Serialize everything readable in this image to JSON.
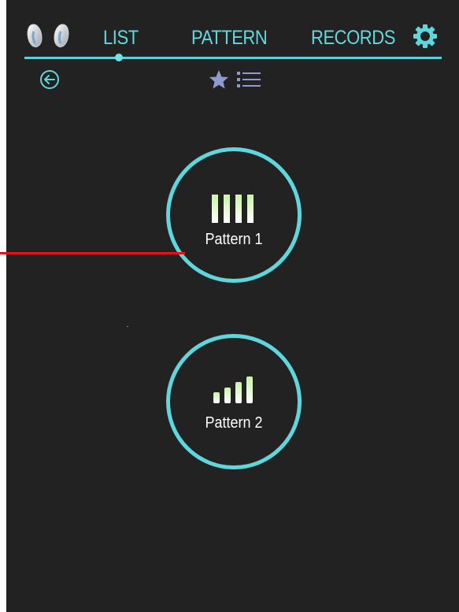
{
  "nav": {
    "tabs": [
      {
        "label": "LIST"
      },
      {
        "label": "PATTERN"
      },
      {
        "label": "RECORDS"
      }
    ],
    "selected_tab": "LIST"
  },
  "toolbar": {
    "icons": [
      "back-arrow-icon",
      "star-icon",
      "list-icon"
    ]
  },
  "patterns": [
    {
      "label": "Pattern 1",
      "icon": "equal-bars-icon"
    },
    {
      "label": "Pattern 2",
      "icon": "ascending-bars-icon"
    }
  ],
  "colors": {
    "background": "#222222",
    "accent": "#5fd6dc",
    "bar_gradient_top": "#c9f2a8",
    "bar_gradient_bottom": "#ffffff",
    "annotation_line": "#e0141b"
  }
}
